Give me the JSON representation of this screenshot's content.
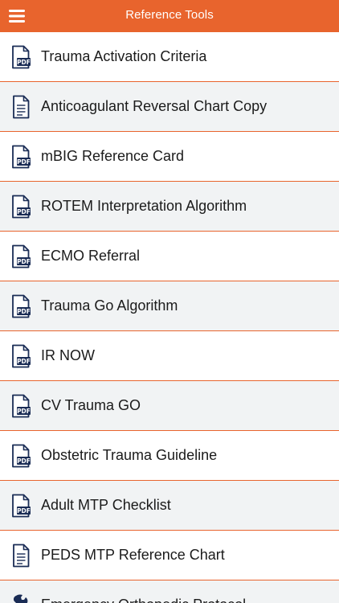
{
  "header": {
    "title": "Reference Tools",
    "menu_icon": "hamburger-menu-icon",
    "background_color": "#e8642d"
  },
  "colors": {
    "accent": "#e8642d",
    "row_alt": "#f1f3f4",
    "icon": "#1a2c55"
  },
  "items": [
    {
      "label": "Trauma Activation Criteria",
      "icon": "pdf-file-icon"
    },
    {
      "label": "Anticoagulant Reversal Chart Copy",
      "icon": "document-icon"
    },
    {
      "label": "mBIG Reference Card",
      "icon": "pdf-file-icon"
    },
    {
      "label": "ROTEM Interpretation Algorithm",
      "icon": "pdf-file-icon"
    },
    {
      "label": "ECMO Referral",
      "icon": "pdf-file-icon"
    },
    {
      "label": "Trauma Go Algorithm",
      "icon": "pdf-file-icon"
    },
    {
      "label": "IR NOW",
      "icon": "pdf-file-icon"
    },
    {
      "label": "CV Trauma GO",
      "icon": "pdf-file-icon"
    },
    {
      "label": "Obstetric Trauma Guideline",
      "icon": "pdf-file-icon"
    },
    {
      "label": "Adult MTP Checklist",
      "icon": "pdf-file-icon"
    },
    {
      "label": "PEDS MTP Reference Chart",
      "icon": "document-icon"
    },
    {
      "label": "Emergency Orthopedic Protocol",
      "icon": "wrench-icon"
    }
  ]
}
